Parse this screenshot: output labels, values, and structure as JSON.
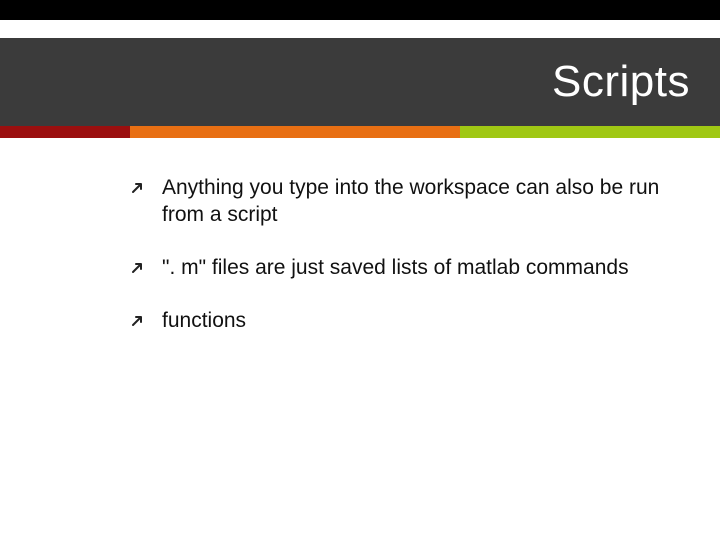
{
  "colors": {
    "topbar": "#000000",
    "titleband": "#3b3b3b",
    "accent1": "#9b0f0f",
    "accent2": "#e86f13",
    "accent3": "#a0c814",
    "arrow": "#222222"
  },
  "title": "Scripts",
  "bullets": [
    "Anything you type into the workspace can also be run from a script",
    "\". m\" files are just saved lists of matlab commands",
    "functions"
  ]
}
